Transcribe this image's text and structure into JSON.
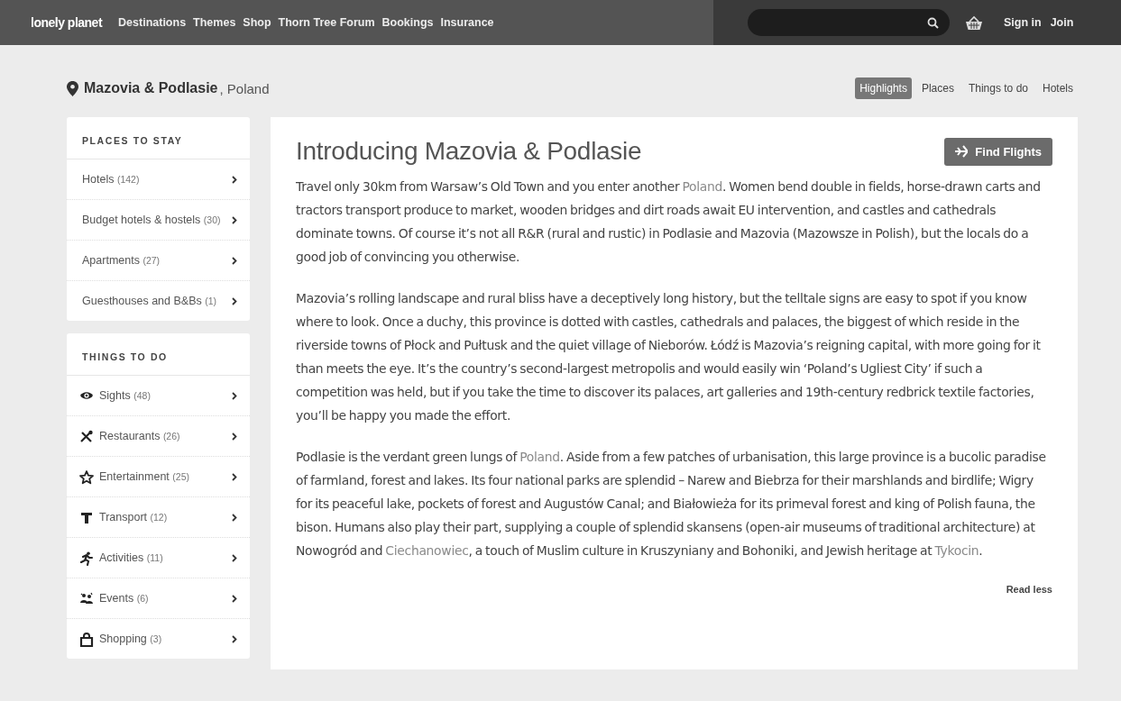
{
  "nav": {
    "logo": "lonely planet",
    "links": [
      "Destinations",
      "Themes",
      "Shop",
      "Thorn Tree Forum",
      "Bookings",
      "Insurance"
    ],
    "account_links": [
      "Sign in",
      "Join"
    ]
  },
  "location": {
    "region": "Mazovia & Podlasie",
    "country": ", Poland"
  },
  "tabs": [
    {
      "label": "Highlights",
      "selected": true
    },
    {
      "label": "Places",
      "selected": false
    },
    {
      "label": "Things to do",
      "selected": false
    },
    {
      "label": "Hotels",
      "selected": false
    }
  ],
  "sidebar": [
    {
      "heading": "PLACES TO STAY",
      "items": [
        {
          "kind": "plain",
          "label": "Hotels",
          "count": "(142)"
        },
        {
          "kind": "plain",
          "label": "Budget hotels & hostels",
          "count": "(30)"
        },
        {
          "kind": "plain",
          "label": "Apartments",
          "count": "(27)"
        },
        {
          "kind": "plain",
          "label": "Guesthouses and B&Bs",
          "count": "(1)"
        }
      ]
    },
    {
      "heading": "THINGS TO DO",
      "items": [
        {
          "kind": "sights",
          "label": "Sights",
          "count": "(48)"
        },
        {
          "kind": "restaurants",
          "label": "Restaurants",
          "count": "(26)"
        },
        {
          "kind": "entertainment",
          "label": "Entertainment",
          "count": "(25)"
        },
        {
          "kind": "transport",
          "label": "Transport",
          "count": "(12)"
        },
        {
          "kind": "activities",
          "label": "Activities",
          "count": "(11)"
        },
        {
          "kind": "events",
          "label": "Events",
          "count": "(6)"
        },
        {
          "kind": "shopping",
          "label": "Shopping",
          "count": "(3)"
        }
      ]
    }
  ],
  "article": {
    "title": "Introducing Mazovia & Podlasie",
    "button": "Find Flights",
    "paragraphs": [
      [
        {
          "text": "Travel only 30km from Warsaw’s Old Town and you enter another ",
          "link": false
        },
        {
          "text": "Poland",
          "link": true
        },
        {
          "text": ". Women bend double in fields, horse-drawn carts and tractors transport produce to market, wooden bridges and dirt roads await EU intervention, and castles and cathedrals dominate towns. Of course it’s not all R&R (rural and rustic) in Podlasie and Mazovia (Mazowsze in Polish), but the locals do a good job of convincing you otherwise.",
          "link": false
        }
      ],
      [
        {
          "text": "Mazovia’s rolling landscape and rural bliss have a deceptively long history, but the telltale signs are easy to spot if you know where to look. Once a duchy, this province is dotted with castles, cathedrals and palaces, the biggest of which reside in the riverside towns of Płock and Pułtusk and the quiet village of Nieborów. Łódź is Mazovia’s reigning capital, with more going for it than meets the eye. It’s the country’s second-largest metropolis and would easily win ‘Poland’s Ugliest City’ if such a competition was held, but if you take the time to discover its palaces, art galleries and 19th-century redbrick textile factories, you’ll be happy you made the effort.",
          "link": false
        }
      ],
      [
        {
          "text": "Podlasie is the verdant green lungs of ",
          "link": false
        },
        {
          "text": "Poland",
          "link": true
        },
        {
          "text": ". Aside from a few patches of urbanisation, this large province is a bucolic paradise of farmland, forest and lakes. Its four national parks are splendid – Narew and Biebrza for their marshlands and birdlife; Wigry for its peaceful lake, pockets of forest and Augustów Canal; and Białowieża for its primeval forest and king of Polish fauna, the bison. Humans also play their part, supplying a couple of splendid skansens (open-air museums of traditional architecture) at Nowogród and ",
          "link": false
        },
        {
          "text": "Ciechanowiec",
          "link": true
        },
        {
          "text": ", a touch of Muslim culture in Kruszyniany and Bohoniki, and Jewish heritage at ",
          "link": false
        },
        {
          "text": "Tykocin",
          "link": true
        },
        {
          "text": ".",
          "link": false
        }
      ]
    ],
    "toggle": "Read less"
  }
}
